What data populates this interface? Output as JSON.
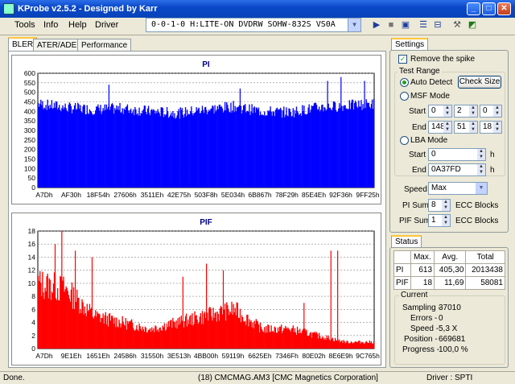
{
  "window": {
    "title": "KProbe v2.5.2 - Designed by Karr"
  },
  "menu": [
    "Tools",
    "Info",
    "Help",
    "Driver"
  ],
  "drive_select": {
    "value": "0-0-1-0 H:LITE-ON DVDRW SOHW-832S  VS0A"
  },
  "toolbar": {
    "icons": [
      "play-icon",
      "stop-icon",
      "save-icon",
      "layout-icon",
      "settings-icon",
      "wrench-icon",
      "image-icon"
    ]
  },
  "tabs": [
    "BLER",
    "ATER/ADER",
    "Performance"
  ],
  "chart_data": [
    {
      "type": "bar",
      "title": "PI",
      "color": "#0000ff",
      "ylim": [
        0,
        600
      ],
      "yticks": [
        0,
        50,
        100,
        150,
        200,
        250,
        300,
        350,
        400,
        450,
        500,
        550,
        600
      ],
      "xticks": [
        "A7Dh",
        "AF30h",
        "18F54h",
        "27606h",
        "3511Eh",
        "42E75h",
        "503F8h",
        "5E034h",
        "6B867h",
        "78F29h",
        "85E4Eh",
        "92F36h",
        "9FF25h"
      ],
      "baseline": [
        440,
        420,
        410,
        415,
        400,
        390,
        410,
        425,
        400,
        395,
        420,
        430,
        440
      ],
      "spikes": [
        [
          0.21,
          540
        ],
        [
          0.6,
          520
        ],
        [
          0.86,
          560
        ],
        [
          0.9,
          580
        ],
        [
          0.97,
          560
        ]
      ]
    },
    {
      "type": "bar",
      "title": "PIF",
      "color": "#ff0000",
      "ylim": [
        0,
        18
      ],
      "yticks": [
        0,
        2,
        4,
        6,
        8,
        10,
        12,
        14,
        16,
        18
      ],
      "xticks": [
        "A7Dh",
        "9E1Eh",
        "1651Eh",
        "24586h",
        "31550h",
        "3E513h",
        "4BB00h",
        "59119h",
        "6625Eh",
        "7346Fh",
        "80E02h",
        "8E6E9h",
        "9C765h"
      ],
      "baseline": [
        10,
        9,
        5,
        4,
        3,
        4,
        5,
        6,
        3,
        3,
        2,
        1,
        1
      ],
      "spikes": [
        [
          0.05,
          16
        ],
        [
          0.07,
          18
        ],
        [
          0.11,
          15
        ],
        [
          0.16,
          14
        ],
        [
          0.43,
          11
        ],
        [
          0.5,
          13
        ],
        [
          0.55,
          12
        ],
        [
          0.79,
          7
        ],
        [
          0.87,
          15
        ],
        [
          0.89,
          15
        ]
      ]
    }
  ],
  "settings": {
    "tab": "Settings",
    "remove_spike": "Remove the spike",
    "test_range": "Test Range",
    "auto_detect": "Auto Detect",
    "check_size": "Check Size",
    "msf_mode": "MSF Mode",
    "start_label": "Start",
    "end_label": "End",
    "msf_start": [
      "0",
      "2",
      "0"
    ],
    "msf_end": [
      "148",
      "51",
      "18"
    ],
    "lba_mode": "LBA Mode",
    "lba_start": "0",
    "lba_end": "0A37FD",
    "h_unit": "h",
    "speed_label": "Speed",
    "speed_value": "Max",
    "pi_sum_label": "PI Sum",
    "pi_sum_value": "8",
    "pif_sum_label": "PIF Sum",
    "pif_sum_value": "1",
    "ecc_blocks": "ECC Blocks"
  },
  "status": {
    "tab": "Status",
    "headers": [
      "Max.",
      "Avg.",
      "Total"
    ],
    "rows": [
      {
        "name": "PI",
        "max": "613",
        "avg": "405,30",
        "total": "2013438"
      },
      {
        "name": "PIF",
        "max": "18",
        "avg": "11,69",
        "total": "58081"
      }
    ],
    "current": "Current",
    "sampling_label": "Sampling -",
    "sampling": "37010",
    "errors_label": "Errors -",
    "errors": "0",
    "speed_label": "Speed -",
    "speed": "5,3 X",
    "position_label": "Position -",
    "position": "669681",
    "progress_label": "Progress -",
    "progress": "100,0 %"
  },
  "statusbar": {
    "left": "Done.",
    "center": "(18) CMCMAG.AM3 [CMC Magnetics Corporation]",
    "right": "Driver : SPTI"
  }
}
